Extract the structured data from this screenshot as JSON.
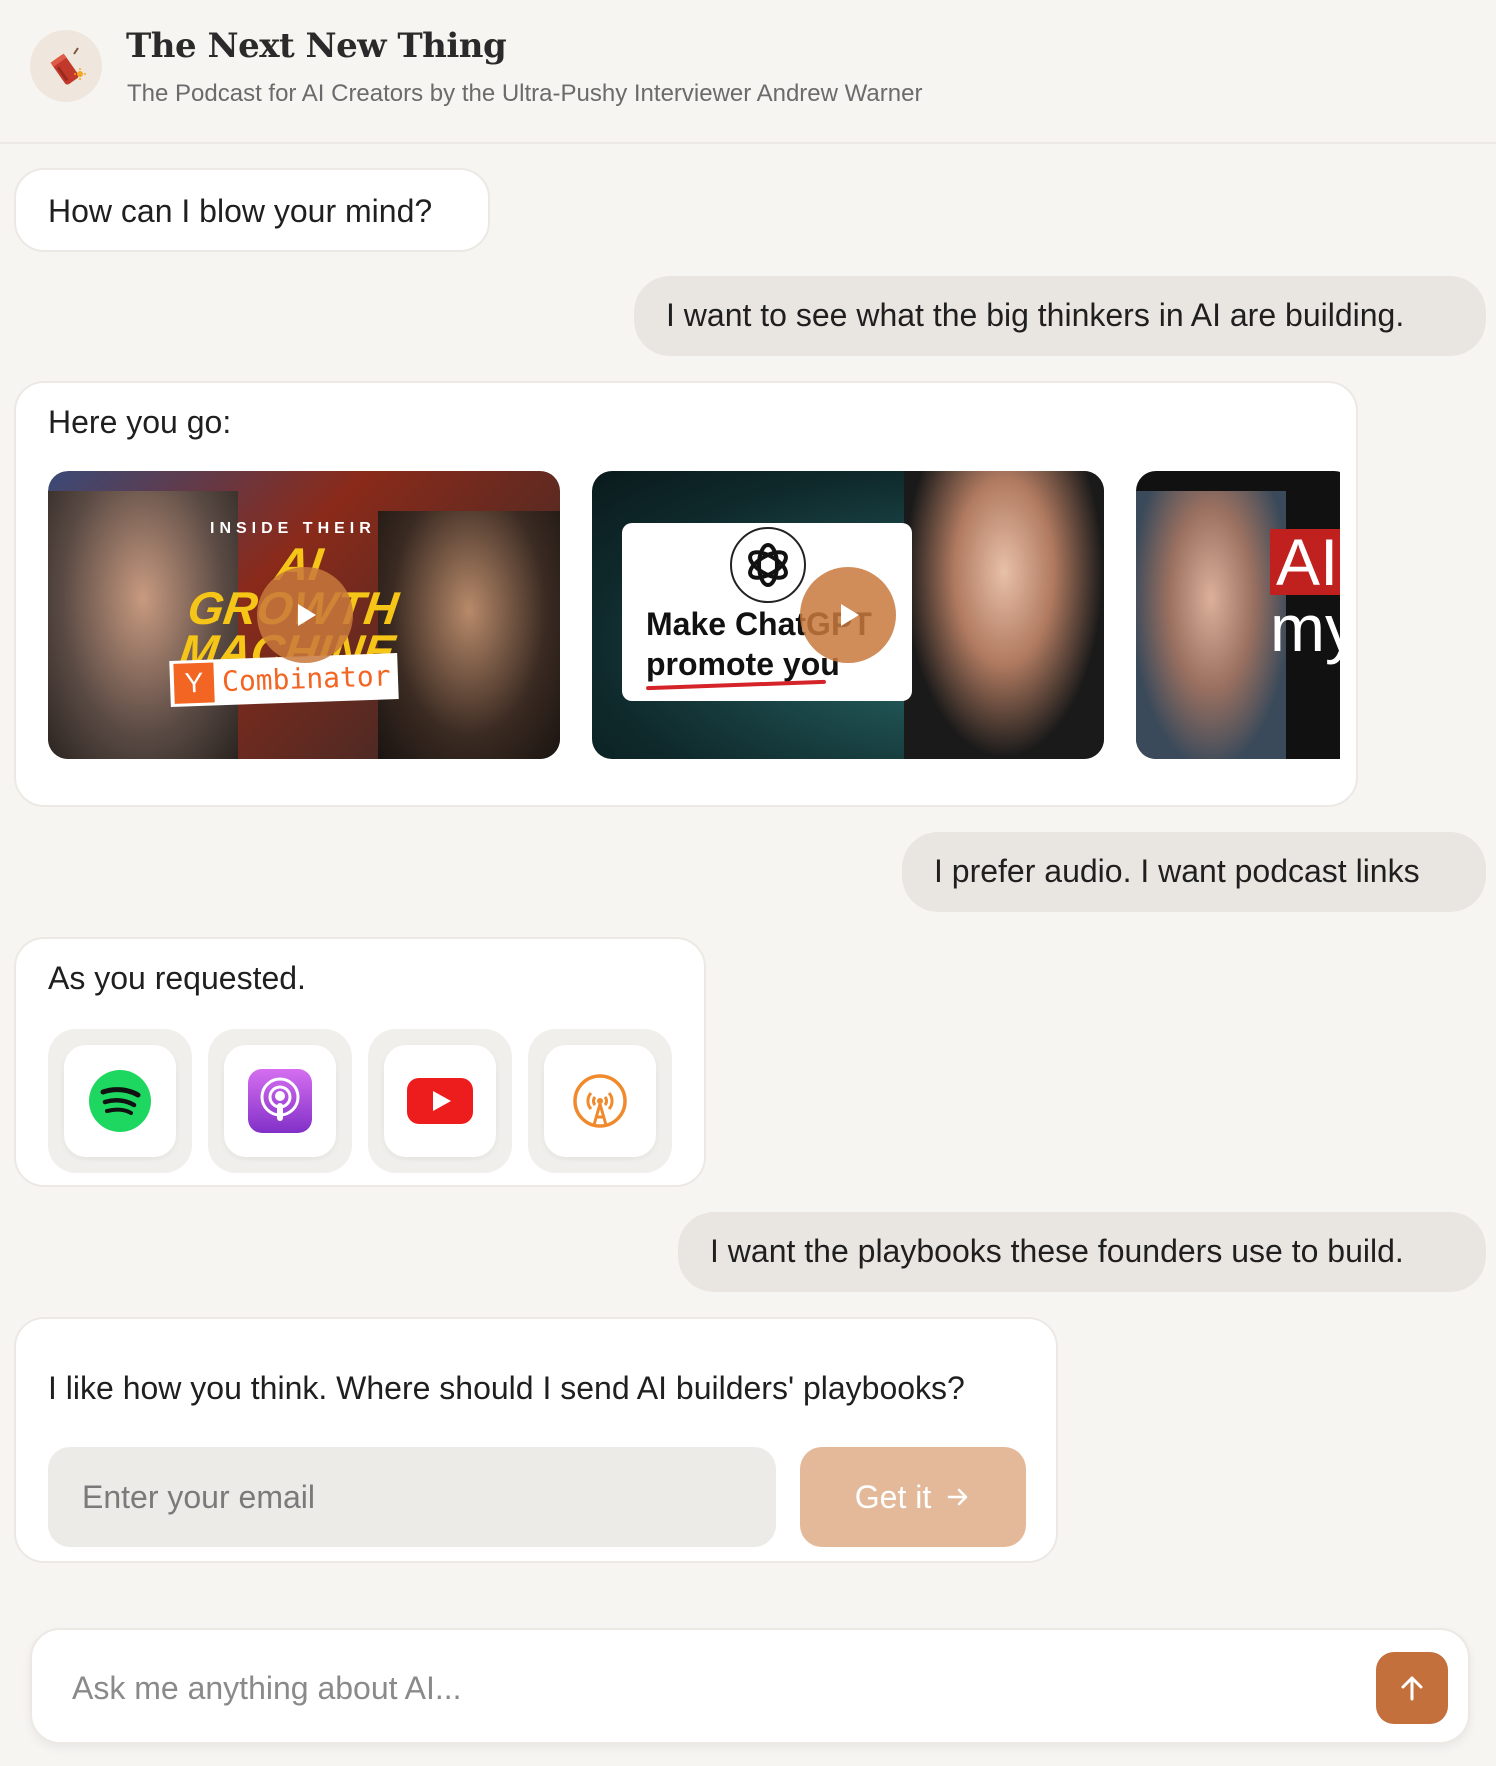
{
  "header": {
    "title": "The Next New Thing",
    "subtitle": "The Podcast for AI Creators by the Ultra-Pushy Interviewer Andrew Warner",
    "logo_icon": "firecracker-icon"
  },
  "messages": {
    "bot_greeting": "How can I blow your mind?",
    "user_1": "I want to see what the big thinkers in AI are building.",
    "bot_videos_intro": "Here you go:",
    "user_2": "I prefer audio. I want podcast links",
    "bot_podcasts_intro": "As you requested.",
    "user_3": "I want the playbooks these founders use to build.",
    "bot_playbooks_prompt": "I like how you think. Where should I send AI builders' playbooks?"
  },
  "videos": [
    {
      "kicker": "INSIDE THEIR",
      "headline": "AI GROWTH MACHINE",
      "badge_letter": "Y",
      "badge_text": "Combinator"
    },
    {
      "headline_1": "Make ChatGPT",
      "headline_2": "promote you"
    },
    {
      "headline_1": "AI",
      "headline_2": "my"
    }
  ],
  "podcast_links": [
    {
      "icon": "spotify-icon",
      "color": "#1ed760"
    },
    {
      "icon": "apple-podcasts-icon",
      "color": "#9a3fd6"
    },
    {
      "icon": "youtube-icon",
      "color": "#ff0000"
    },
    {
      "icon": "overcast-icon",
      "color": "#f08a2c"
    }
  ],
  "email_form": {
    "placeholder": "Enter your email",
    "button_label": "Get it"
  },
  "ask_bar": {
    "placeholder": "Ask me anything about AI..."
  },
  "colors": {
    "accent": "#c4703d",
    "accent_light": "#e3b99a",
    "background": "#f7f5f2"
  }
}
